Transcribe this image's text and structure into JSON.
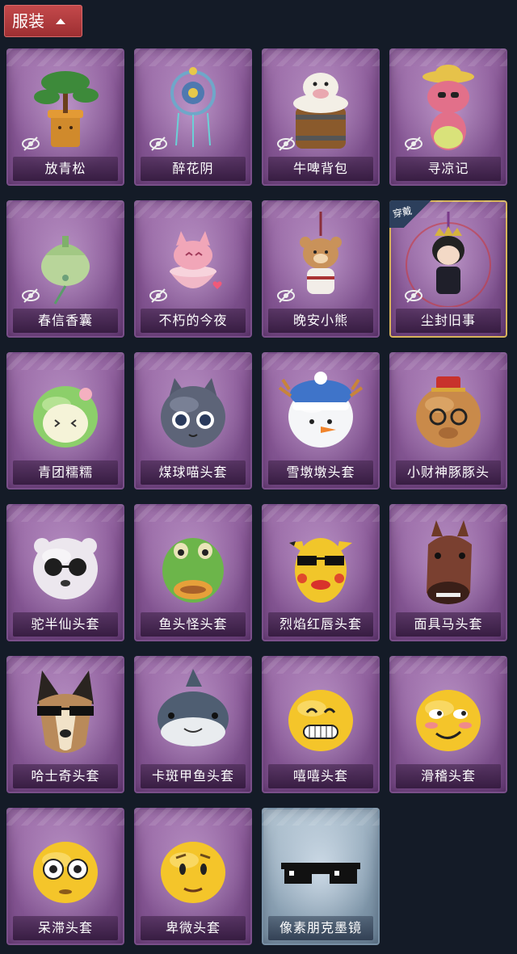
{
  "header": {
    "tab_label": "服装",
    "tab_icon": "chevron-up-icon"
  },
  "items": [
    {
      "name": "放青松",
      "hidden": true,
      "art": "bonsai-pine"
    },
    {
      "name": "醉花阴",
      "hidden": true,
      "art": "dreamcatcher"
    },
    {
      "name": "牛啤背包",
      "hidden": true,
      "art": "cow-beer-barrel"
    },
    {
      "name": "寻凉记",
      "hidden": true,
      "art": "pink-creature-hat"
    },
    {
      "name": "春信香囊",
      "hidden": true,
      "art": "green-sachet"
    },
    {
      "name": "不朽的今夜",
      "hidden": true,
      "art": "pink-fox-bowl"
    },
    {
      "name": "晚安小熊",
      "hidden": true,
      "art": "teddy-bear-charm"
    },
    {
      "name": "尘封旧事",
      "hidden": true,
      "worn": true,
      "worn_label": "穿戴",
      "art": "chibi-doll-charm"
    },
    {
      "name": "青团糯糯",
      "hidden": false,
      "art": "green-rice-ball-head"
    },
    {
      "name": "煤球喵头套",
      "hidden": false,
      "art": "gray-cat-head"
    },
    {
      "name": "雪墩墩头套",
      "hidden": false,
      "art": "snowman-head"
    },
    {
      "name": "小财神豚豚头",
      "hidden": false,
      "art": "capybara-head"
    },
    {
      "name": "驼半仙头套",
      "hidden": false,
      "art": "white-bear-sunglasses"
    },
    {
      "name": "鱼头怪头套",
      "hidden": false,
      "art": "fish-head"
    },
    {
      "name": "烈焰红唇头套",
      "hidden": false,
      "art": "yellow-pika-head"
    },
    {
      "name": "面具马头套",
      "hidden": false,
      "art": "horse-head"
    },
    {
      "name": "哈士奇头套",
      "hidden": false,
      "art": "husky-head"
    },
    {
      "name": "卡斑甲鱼头套",
      "hidden": false,
      "art": "whale-shark-head"
    },
    {
      "name": "嘻嘻头套",
      "hidden": false,
      "art": "grin-emoji-head"
    },
    {
      "name": "滑稽头套",
      "hidden": false,
      "art": "funny-emoji-head"
    },
    {
      "name": "呆滞头套",
      "hidden": false,
      "art": "stunned-emoji-head"
    },
    {
      "name": "卑微头套",
      "hidden": false,
      "art": "timid-emoji-head"
    },
    {
      "name": "像素朋克墨镜",
      "hidden": false,
      "rarity": "blue",
      "art": "pixel-sunglasses"
    }
  ]
}
